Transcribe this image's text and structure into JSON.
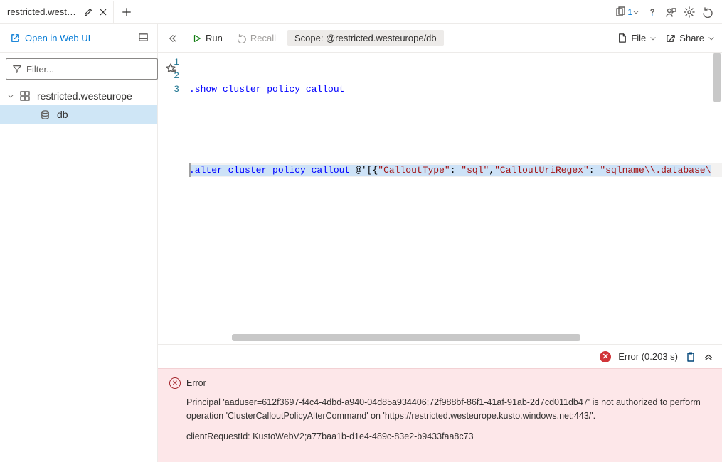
{
  "tab": {
    "title": "restricted.westeur..."
  },
  "top": {
    "copy_count": "1",
    "icons": [
      "copy",
      "chevron",
      "help",
      "feedback",
      "settings",
      "undo"
    ]
  },
  "sidebar": {
    "open_web": "Open in Web UI",
    "filter_placeholder": "Filter...",
    "cluster": "restricted.westeurope",
    "db": "db"
  },
  "cmdbar": {
    "run": "Run",
    "recall": "Recall",
    "scope_label": "Scope:",
    "scope_value": "@restricted.westeurope/db",
    "file": "File",
    "share": "Share"
  },
  "editor": {
    "lines": [
      "1",
      "2",
      "3"
    ],
    "l1_cmd": ".show",
    "l1_rest": " cluster policy callout",
    "l3_cmd": ".alter",
    "l3_mid": " cluster policy callout ",
    "l3_at": "@'[{",
    "l3_k1": "\"CalloutType\"",
    "l3_c1": ": ",
    "l3_v1": "\"sql\"",
    "l3_c2": ",",
    "l3_k2": "\"CalloutUriRegex\"",
    "l3_c3": ": ",
    "l3_v2": "\"sqlname\\\\.database\\"
  },
  "results": {
    "status": "Error (0.203 s)"
  },
  "error": {
    "title": "Error",
    "body1": "Principal 'aaduser=612f3697-f4c4-4dbd-a940-04d85a934406;72f988bf-86f1-41af-91ab-2d7cd011db47' is not authorized to perform operation 'ClusterCalloutPolicyAlterCommand' on 'https://restricted.westeurope.kusto.windows.net:443/'.",
    "body2": "clientRequestId: KustoWebV2;a77baa1b-d1e4-489c-83e2-b9433faa8c73"
  }
}
